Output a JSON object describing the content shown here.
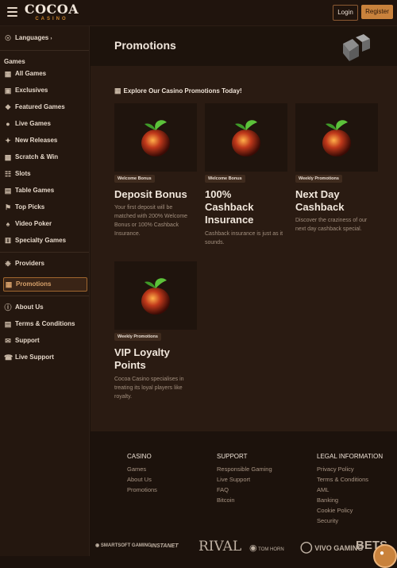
{
  "header": {
    "logo_main": "COCOA",
    "logo_sub": "CASINO",
    "login_label": "Login",
    "register_label": "Register"
  },
  "sidebar": {
    "languages_label": "Languages",
    "games_heading": "Games",
    "items": [
      {
        "label": "All Games",
        "icon": "grid-icon"
      },
      {
        "label": "Exclusives",
        "icon": "cube-icon"
      },
      {
        "label": "Featured Games",
        "icon": "puzzle-icon"
      },
      {
        "label": "Live Games",
        "icon": "camera-icon"
      },
      {
        "label": "New Releases",
        "icon": "sparkle-icon"
      },
      {
        "label": "Scratch & Win",
        "icon": "scratch-icon"
      },
      {
        "label": "Slots",
        "icon": "slots-icon"
      },
      {
        "label": "Table Games",
        "icon": "table-icon"
      },
      {
        "label": "Top Picks",
        "icon": "pin-icon"
      },
      {
        "label": "Video Poker",
        "icon": "poker-icon"
      },
      {
        "label": "Specialty Games",
        "icon": "dice-icon"
      }
    ],
    "providers_label": "Providers",
    "promotions_label": "Promotions",
    "bottom_items": [
      {
        "label": "About Us",
        "icon": "info-icon"
      },
      {
        "label": "Terms & Conditions",
        "icon": "document-icon"
      },
      {
        "label": "Support",
        "icon": "chat-icon"
      },
      {
        "label": "Live Support",
        "icon": "headset-icon"
      }
    ]
  },
  "main": {
    "page_title": "Promotions",
    "explore_text": "Explore Our Casino Promotions Today!",
    "cards": [
      {
        "badge": "Welcome Bonus",
        "title": "Deposit Bonus",
        "desc": "Your first deposit will be matched with 200% Welcome Bonus or 100% Cashback Insurance."
      },
      {
        "badge": "Welcome Bonus",
        "title": "100% Cashback Insurance",
        "desc": "Cashback insurance is just as it sounds."
      },
      {
        "badge": "Weekly Promotions",
        "title": "Next Day Cashback",
        "desc": "Discover the craziness of our next day cashback special."
      },
      {
        "badge": "Weekly Promotions",
        "title": "VIP Loyalty Points",
        "desc": "Cocoa Casino specialises in treating its loyal players like royalty."
      }
    ]
  },
  "footer": {
    "columns": [
      {
        "heading": "CASINO",
        "links": [
          "Games",
          "About Us",
          "Promotions"
        ]
      },
      {
        "heading": "SUPPORT",
        "links": [
          "Responsible Gaming",
          "Live Support",
          "FAQ",
          "Bitcoin"
        ]
      },
      {
        "heading": "LEGAL INFORMATION",
        "links": [
          "Privacy Policy",
          "Terms & Conditions",
          "AML",
          "Banking",
          "Cookie Policy",
          "Security"
        ]
      }
    ],
    "providers": [
      "SMARTSOFT GAMING",
      "INSTANET",
      "RIVAL",
      "TOM HORN",
      "VIVO GAMING",
      "BETS"
    ]
  },
  "colors": {
    "accent": "#c9823c",
    "background": "#1c120c",
    "panel": "#2a1b12"
  }
}
